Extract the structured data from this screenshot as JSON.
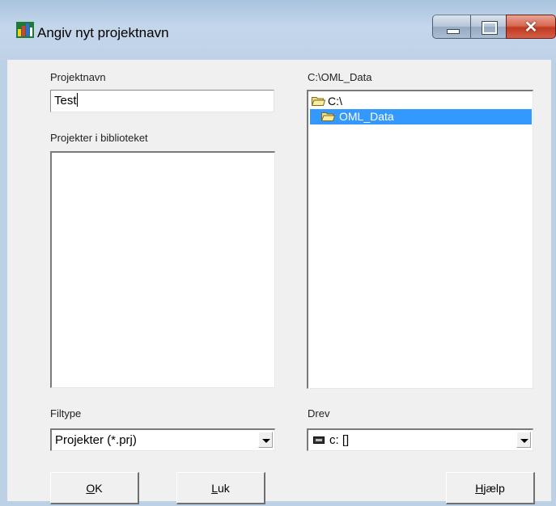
{
  "window": {
    "title": "Angiv nyt projektnavn"
  },
  "left": {
    "name_label": "Projektnavn",
    "name_value": "Test",
    "library_label": "Projekter i biblioteket",
    "library_items": [],
    "filetype_label": "Filtype",
    "filetype_value": "Projekter (*.prj)"
  },
  "right": {
    "path_label": "C:\\OML_Data",
    "directories": [
      {
        "label": "C:\\",
        "icon": "open-folder-icon",
        "selected": false
      },
      {
        "label": "OML_Data",
        "icon": "open-folder-icon",
        "selected": true
      }
    ],
    "drive_label": "Drev",
    "drive_value": "c: []"
  },
  "buttons": {
    "ok": {
      "accel": "O",
      "rest": "K"
    },
    "close": {
      "accel": "L",
      "rest": "uk"
    },
    "help": {
      "accel": "H",
      "rest": "jælp"
    }
  },
  "colors": {
    "selection": "#3399ff",
    "close_button": "#c8442b",
    "titlebar": "#bfd2e8"
  }
}
